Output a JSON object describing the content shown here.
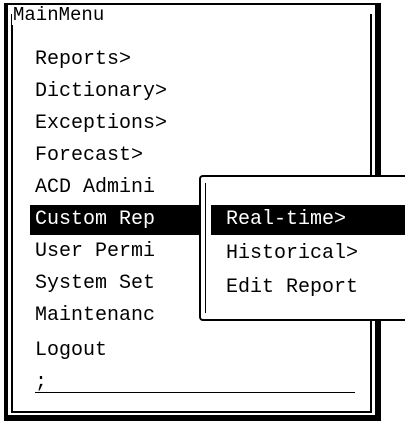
{
  "menu": {
    "title": "MainMenu",
    "items": [
      {
        "label": "Reports>",
        "selected": false
      },
      {
        "label": "Dictionary>",
        "selected": false
      },
      {
        "label": "Exceptions>",
        "selected": false
      },
      {
        "label": "Forecast>",
        "selected": false
      },
      {
        "label": "ACD Admini",
        "selected": false
      },
      {
        "label": "Custom Rep",
        "selected": true
      },
      {
        "label": "User Permi",
        "selected": false
      },
      {
        "label": "System Set",
        "selected": false
      },
      {
        "label": "Maintenanc",
        "selected": false
      },
      {
        "label": "Logout",
        "selected": false
      }
    ],
    "prompt": ";"
  },
  "submenu": {
    "items": [
      {
        "label": "Real-time>",
        "selected": true
      },
      {
        "label": "Historical>",
        "selected": false
      },
      {
        "label": "Edit Report",
        "selected": false
      }
    ]
  },
  "colors": {
    "background": "#ffffff",
    "foreground": "#000000",
    "highlight_bg": "#000000",
    "highlight_fg": "#ffffff"
  }
}
